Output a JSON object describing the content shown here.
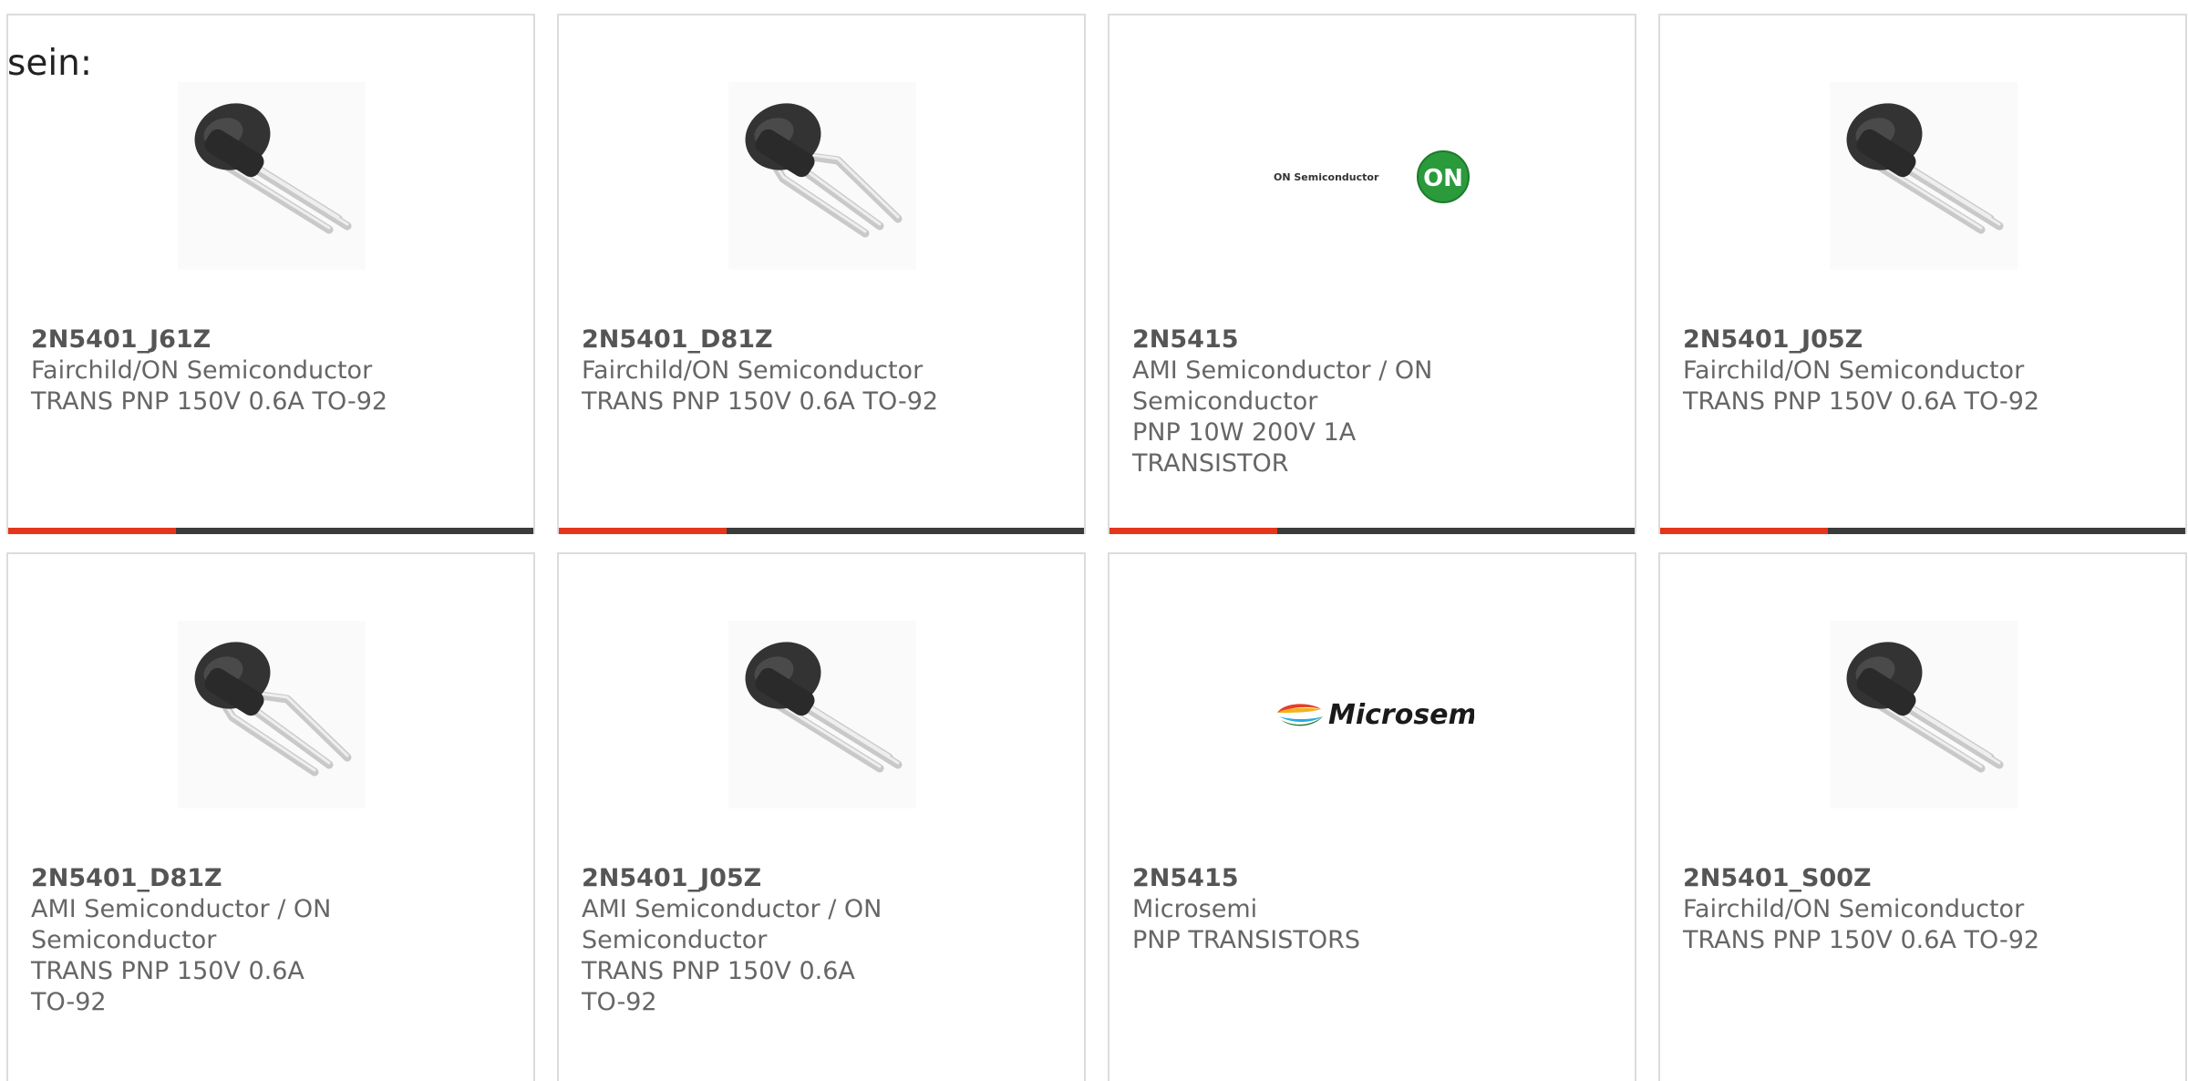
{
  "intro": {
    "text": "sein:"
  },
  "colors": {
    "accent": "#e4361b",
    "bar": "#3b3b3b",
    "border": "#dcdcdc",
    "text": "#666666"
  },
  "products": [
    {
      "part": "2N5401_J61Z",
      "manufacturer": "Fairchild/ON Semiconductor",
      "description": "TRANS PNP 150V 0.6A TO-92",
      "image": "to92-transistor-straight",
      "bar_progress": 0.32
    },
    {
      "part": "2N5401_D81Z",
      "manufacturer": "Fairchild/ON Semiconductor",
      "description": "TRANS PNP 150V 0.6A TO-92",
      "image": "to92-transistor-bent-leads",
      "bar_progress": 0.32
    },
    {
      "part": "2N5415",
      "manufacturer": "AMI Semiconductor / ON Semiconductor",
      "description": "PNP 10W 200V 1A TRANSISTOR",
      "image": "on-semiconductor-logo",
      "logo_text": "ON Semiconductor",
      "logo_badge": "ON",
      "bar_progress": 0.32
    },
    {
      "part": "2N5401_J05Z",
      "manufacturer": "Fairchild/ON Semiconductor",
      "description": "TRANS PNP 150V 0.6A TO-92",
      "image": "to92-transistor-straight",
      "bar_progress": 0.32
    },
    {
      "part": "2N5401_D81Z",
      "manufacturer": "AMI Semiconductor / ON Semiconductor",
      "description": "TRANS PNP 150V 0.6A TO-92",
      "image": "to92-transistor-bent-leads"
    },
    {
      "part": "2N5401_J05Z",
      "manufacturer": "AMI Semiconductor / ON Semiconductor",
      "description": "TRANS PNP 150V 0.6A TO-92",
      "image": "to92-transistor-straight"
    },
    {
      "part": "2N5415",
      "manufacturer": "Microsemi",
      "description": "PNP TRANSISTORS",
      "image": "microsemi-logo",
      "logo_text": "Microsemi"
    },
    {
      "part": "2N5401_S00Z",
      "manufacturer": "Fairchild/ON Semiconductor",
      "description": "TRANS PNP 150V 0.6A TO-92",
      "image": "to92-transistor-straight"
    }
  ]
}
